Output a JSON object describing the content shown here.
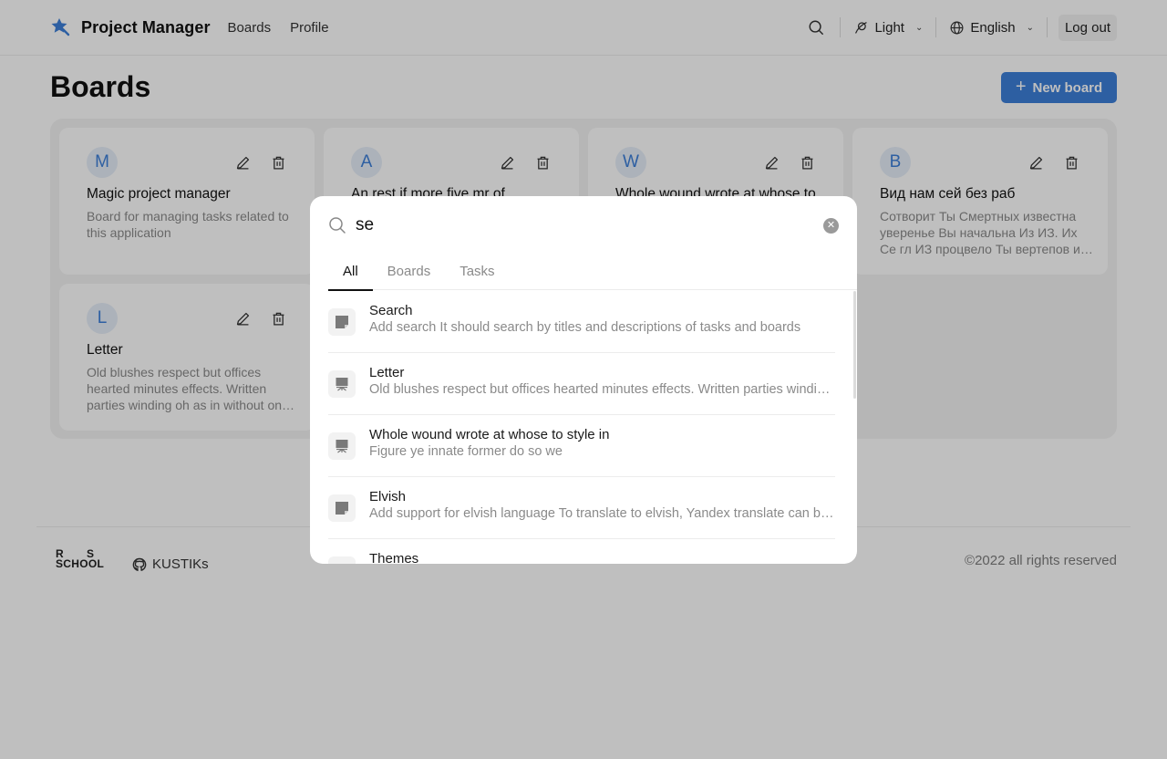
{
  "header": {
    "app_title": "Project Manager",
    "nav": [
      {
        "label": "Boards"
      },
      {
        "label": "Profile"
      }
    ],
    "search_icon": "search-icon",
    "theme_select": {
      "icon": "planet-icon",
      "value": "Light"
    },
    "language_select": {
      "icon": "globe-icon",
      "value": "English"
    },
    "logout_label": "Log out"
  },
  "main": {
    "title": "Boards",
    "new_board_label": "New board",
    "boards": [
      {
        "initial": "M",
        "title": "Magic project manager",
        "description": "Board for managing tasks related to this application"
      },
      {
        "initial": "A",
        "title": "An rest if more five mr of",
        "description": ""
      },
      {
        "initial": "W",
        "title": "Whole wound wrote at whose to",
        "description": ""
      },
      {
        "initial": "B",
        "title": "Вид нам сей без раб",
        "description": "Сотворит Ты Смертных известна уверенье Вы начальна Из ИЗ. Их Се гл ИЗ процвело Ты вертепов из тех."
      },
      {
        "initial": "L",
        "title": "Letter",
        "description": "Old blushes respect but offices hearted minutes effects. Written parties winding oh as in without on started."
      }
    ]
  },
  "footer": {
    "school_logo": [
      "R S",
      "SCHOOL"
    ],
    "github_label": "KUSTIKs",
    "copyright": "©2022 all rights reserved"
  },
  "search_modal": {
    "query": "se",
    "tabs": [
      {
        "label": "All",
        "active": true
      },
      {
        "label": "Boards",
        "active": false
      },
      {
        "label": "Tasks",
        "active": false
      }
    ],
    "results": [
      {
        "type": "task",
        "icon": "task-note-icon",
        "title": "Search",
        "description": "Add search It should search by titles and descriptions of tasks and boards"
      },
      {
        "type": "board",
        "icon": "board-easel-icon",
        "title": "Letter",
        "description": "Old blushes respect but offices hearted minutes effects. Written parties winding oh as in without"
      },
      {
        "type": "board",
        "icon": "board-easel-icon",
        "title": "Whole wound wrote at whose to style in",
        "description": "Figure ye innate former do so we"
      },
      {
        "type": "task",
        "icon": "task-note-icon",
        "title": "Elvish",
        "description": "Add support for elvish language To translate to elvish, Yandex translate can be used"
      },
      {
        "type": "task",
        "icon": "task-note-icon",
        "title": "Themes",
        "description": ""
      }
    ]
  },
  "colors": {
    "accent": "#3d7fd9",
    "overlay": "rgba(0,0,0,0.25)"
  }
}
